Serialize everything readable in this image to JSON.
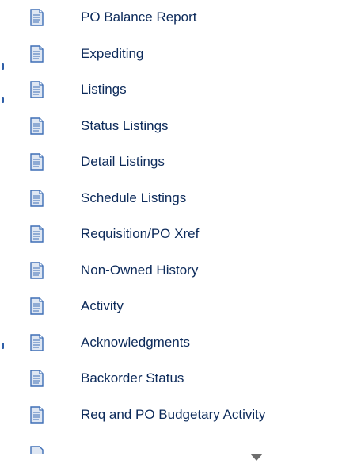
{
  "report_menu": {
    "items": [
      {
        "label": "PO Balance Report",
        "icon": "document-icon"
      },
      {
        "label": "Expediting",
        "icon": "document-icon"
      },
      {
        "label": "Listings",
        "icon": "document-icon"
      },
      {
        "label": "Status Listings",
        "icon": "document-icon"
      },
      {
        "label": "Detail Listings",
        "icon": "document-icon"
      },
      {
        "label": "Schedule Listings",
        "icon": "document-icon"
      },
      {
        "label": "Requisition/PO Xref",
        "icon": "document-icon"
      },
      {
        "label": "Non-Owned History",
        "icon": "document-icon"
      },
      {
        "label": "Activity",
        "icon": "document-icon"
      },
      {
        "label": "Acknowledgments",
        "icon": "document-icon"
      },
      {
        "label": "Backorder Status",
        "icon": "document-icon"
      },
      {
        "label": "Req and PO Budgetary Activity",
        "icon": "document-icon"
      }
    ],
    "scroll_indicator_icon": "chevron-down-icon"
  },
  "colors": {
    "label_text": "#0c2a5a",
    "icon_fill": "#dfe7f3",
    "icon_stroke": "#3f6fb6",
    "arrow": "#6d6d6d"
  }
}
